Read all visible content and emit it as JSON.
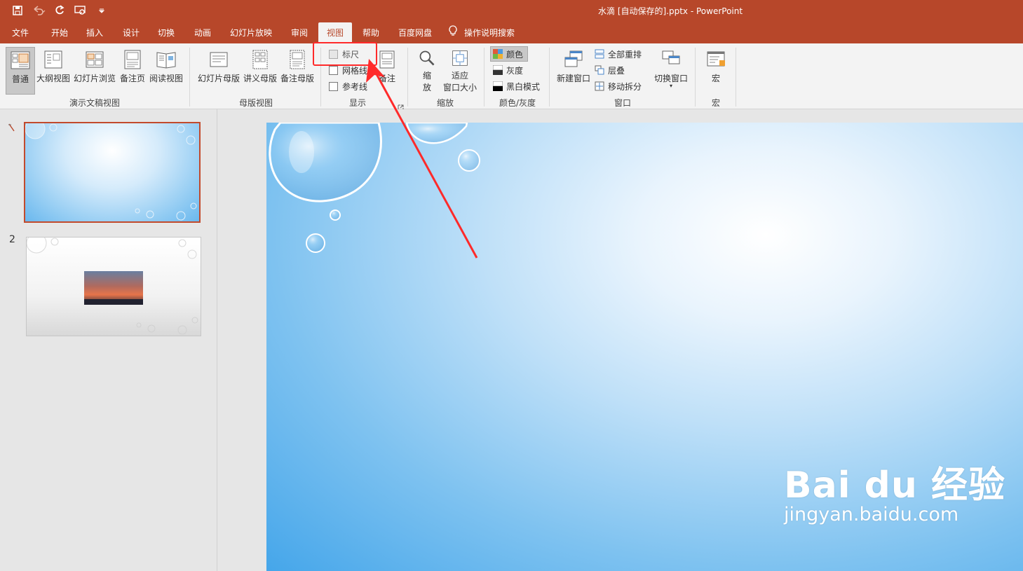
{
  "window": {
    "title": "水滴 [自动保存的].pptx  -  PowerPoint",
    "accent_color": "#b7472a"
  },
  "quick_access": {
    "icons": [
      "save-icon",
      "undo-icon",
      "redo-icon",
      "present-icon",
      "customize-icon"
    ]
  },
  "tabs": [
    {
      "label": "文件"
    },
    {
      "label": "开始"
    },
    {
      "label": "插入"
    },
    {
      "label": "设计"
    },
    {
      "label": "切换"
    },
    {
      "label": "动画"
    },
    {
      "label": "幻灯片放映"
    },
    {
      "label": "审阅"
    },
    {
      "label": "视图",
      "active": true
    },
    {
      "label": "帮助"
    },
    {
      "label": "百度网盘"
    },
    {
      "label": "操作说明搜索"
    }
  ],
  "ribbon": {
    "presentation_views": {
      "label": "演示文稿视图",
      "buttons": [
        "普通",
        "大纲视图",
        "幻灯片浏览",
        "备注页",
        "阅读视图"
      ],
      "selected": "普通"
    },
    "master_views": {
      "label": "母版视图",
      "buttons": [
        "幻灯片母版",
        "讲义母版",
        "备注母版"
      ]
    },
    "show": {
      "label": "显示",
      "checkboxes": [
        {
          "label": "标尺",
          "checked": false,
          "enabled": false
        },
        {
          "label": "网格线",
          "checked": false,
          "enabled": true
        },
        {
          "label": "参考线",
          "checked": false,
          "enabled": true
        }
      ],
      "notes_button": "备注"
    },
    "zoom": {
      "label": "缩放",
      "zoom_button_line1": "缩",
      "zoom_button_line2": "放",
      "fit_button_line1": "适应",
      "fit_button_line2": "窗口大小"
    },
    "color": {
      "label": "颜色/灰度",
      "items": [
        "颜色",
        "灰度",
        "黑白模式"
      ],
      "selected": "颜色"
    },
    "window": {
      "label": "窗口",
      "new_window": "新建窗口",
      "items": [
        "全部重排",
        "层叠",
        "移动拆分"
      ],
      "switch_window": "切换窗口"
    },
    "macros": {
      "label": "宏",
      "button": "宏"
    }
  },
  "slides": [
    {
      "number": "1",
      "selected": true
    },
    {
      "number": "2",
      "selected": false
    }
  ],
  "watermark": {
    "logo_text": "Bai du 经验",
    "url": "jingyan.baidu.com"
  }
}
